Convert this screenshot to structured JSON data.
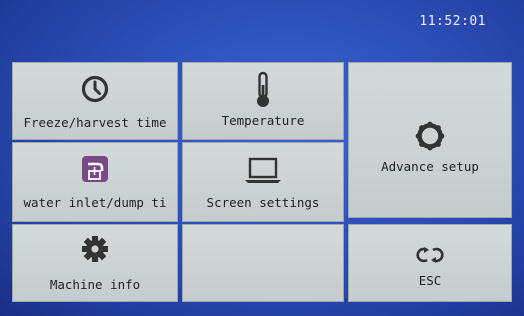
{
  "status": {
    "time": "11:52:01"
  },
  "tiles": {
    "freeze_harvest_time": {
      "label": "Freeze/harvest time",
      "icon": "clock-icon"
    },
    "temperature": {
      "label": "Temperature",
      "icon": "thermometer-icon"
    },
    "advance_setup": {
      "label": "Advance setup",
      "icon": "gear-ring-icon"
    },
    "water_inlet_dump": {
      "label": "water inlet/dump ti",
      "icon": "water-tap-icon"
    },
    "screen_settings": {
      "label": "Screen settings",
      "icon": "laptop-icon"
    },
    "machine_info": {
      "label": "Machine info",
      "icon": "gear-icon"
    },
    "esc": {
      "label": "ESC",
      "icon": "refresh-icon"
    }
  },
  "colors": {
    "background": "#2c4fb8",
    "tile": "#cdd2d3",
    "icon": "#3a3a3a",
    "tap_accent": "#7a4a86"
  }
}
